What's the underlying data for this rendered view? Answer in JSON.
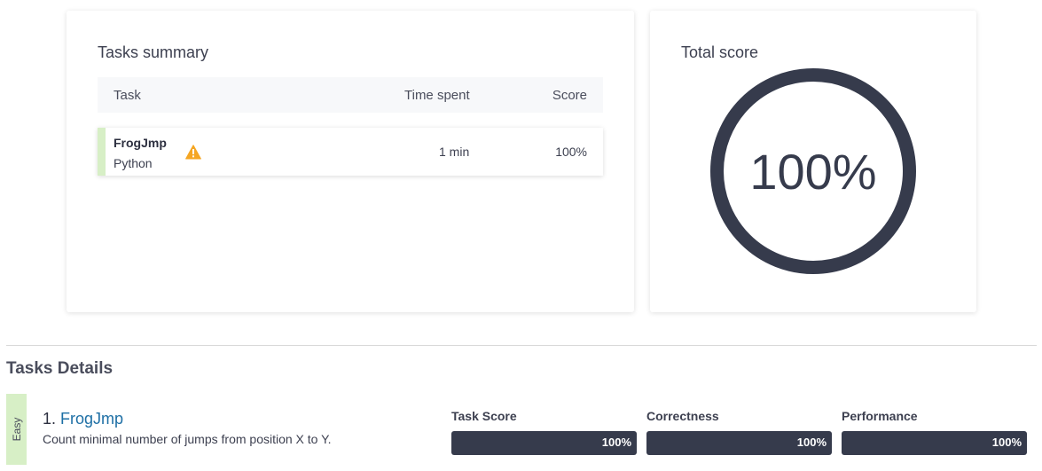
{
  "summary": {
    "title": "Tasks summary",
    "columns": {
      "task": "Task",
      "time": "Time spent",
      "score": "Score"
    },
    "rows": [
      {
        "name": "FrogJmp",
        "language": "Python",
        "time": "1 min",
        "score": "100%",
        "icon": "warning-icon"
      }
    ]
  },
  "total_score": {
    "title": "Total score",
    "value": "100%",
    "percent": 100
  },
  "details": {
    "title": "Tasks Details",
    "tasks": [
      {
        "difficulty": "Easy",
        "number": "1.",
        "name": "FrogJmp",
        "description": "Count minimal number of jumps from position X to Y.",
        "metrics": [
          {
            "label": "Task Score",
            "value": "100%"
          },
          {
            "label": "Correctness",
            "value": "100%"
          },
          {
            "label": "Performance",
            "value": "100%"
          }
        ]
      }
    ]
  },
  "colors": {
    "stripe": "#d7efc6",
    "ring": "#363b4c",
    "bar": "#363b4c",
    "link": "#1d6fa5",
    "warning": "#f5a623"
  }
}
